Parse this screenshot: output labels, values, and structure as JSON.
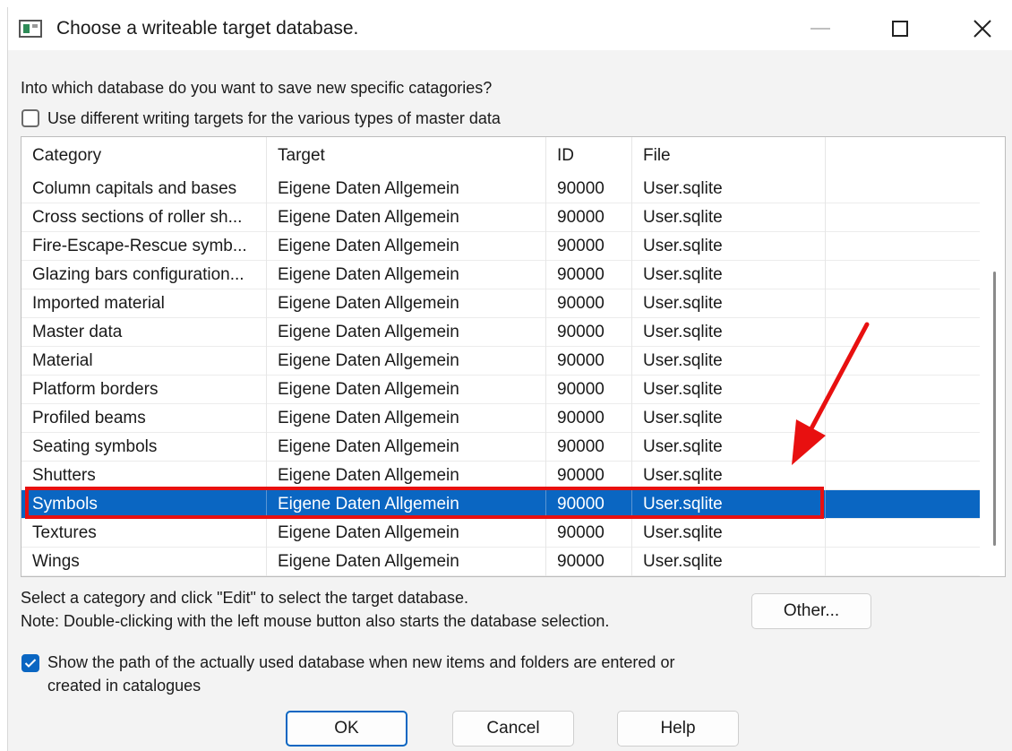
{
  "window": {
    "title": "Choose a writeable target database."
  },
  "question": "Into which database do you want to save new specific catagories?",
  "different_targets": {
    "label": "Use different writing targets for the various types of master data",
    "checked": false
  },
  "table": {
    "columns": [
      "Category",
      "Target",
      "ID",
      "File"
    ],
    "rows": [
      {
        "category": "Column capitals and bases",
        "target": "Eigene Daten Allgemein",
        "id": "90000",
        "file": "User.sqlite"
      },
      {
        "category": "Cross sections of roller sh...",
        "target": "Eigene Daten Allgemein",
        "id": "90000",
        "file": "User.sqlite"
      },
      {
        "category": "Fire-Escape-Rescue symb...",
        "target": "Eigene Daten Allgemein",
        "id": "90000",
        "file": "User.sqlite"
      },
      {
        "category": "Glazing bars configuration...",
        "target": "Eigene Daten Allgemein",
        "id": "90000",
        "file": "User.sqlite"
      },
      {
        "category": "Imported material",
        "target": "Eigene Daten Allgemein",
        "id": "90000",
        "file": "User.sqlite"
      },
      {
        "category": "Master data",
        "target": "Eigene Daten Allgemein",
        "id": "90000",
        "file": "User.sqlite"
      },
      {
        "category": "Material",
        "target": "Eigene Daten Allgemein",
        "id": "90000",
        "file": "User.sqlite"
      },
      {
        "category": "Platform borders",
        "target": "Eigene Daten Allgemein",
        "id": "90000",
        "file": "User.sqlite"
      },
      {
        "category": "Profiled beams",
        "target": "Eigene Daten Allgemein",
        "id": "90000",
        "file": "User.sqlite"
      },
      {
        "category": "Seating symbols",
        "target": "Eigene Daten Allgemein",
        "id": "90000",
        "file": "User.sqlite"
      },
      {
        "category": "Shutters",
        "target": "Eigene Daten Allgemein",
        "id": "90000",
        "file": "User.sqlite"
      },
      {
        "category": "Symbols",
        "target": "Eigene Daten Allgemein",
        "id": "90000",
        "file": "User.sqlite",
        "selected": true
      },
      {
        "category": "Textures",
        "target": "Eigene Daten Allgemein",
        "id": "90000",
        "file": "User.sqlite"
      },
      {
        "category": "Wings",
        "target": "Eigene Daten Allgemein",
        "id": "90000",
        "file": "User.sqlite"
      }
    ]
  },
  "hint": {
    "line1": "Select a category and click \"Edit\" to select the target database.",
    "line2": "Note: Double-clicking with the left mouse button also starts the database selection."
  },
  "show_path": {
    "label": "Show the path of the actually used database when new items and folders are entered or created in catalogues",
    "checked": true
  },
  "buttons": {
    "other": "Other...",
    "ok": "OK",
    "cancel": "Cancel",
    "help": "Help"
  },
  "colors": {
    "selection": "#0a66c2",
    "annotation": "#e81010"
  }
}
